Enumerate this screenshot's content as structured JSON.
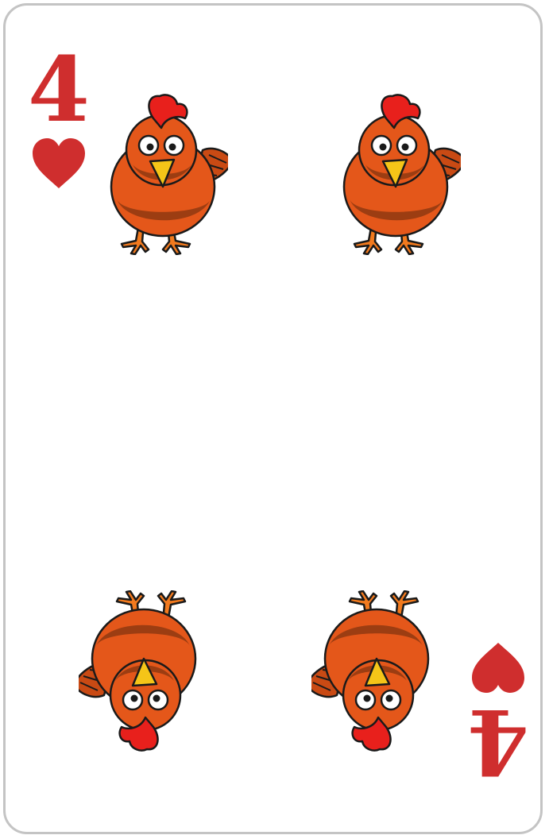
{
  "card": {
    "rank": "4",
    "suit": "hearts",
    "suit_color": "#cf2e2e",
    "pip_icon": "chicken-icon",
    "pip_count": 4,
    "colors": {
      "body": "#e4571a",
      "body_dark": "#9c3d12",
      "comb": "#e8201c",
      "beak": "#f5c518",
      "feet": "#f27a1e",
      "border": "#c4c4c4"
    }
  }
}
